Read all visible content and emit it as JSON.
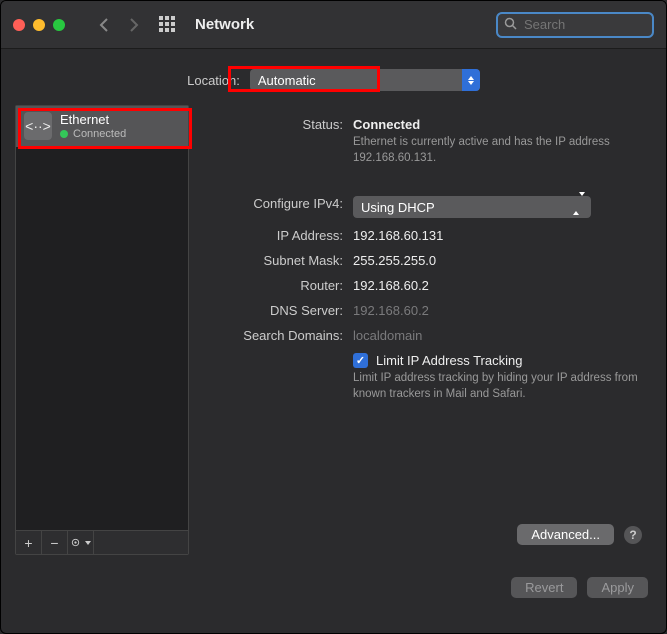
{
  "header": {
    "title": "Network",
    "search_placeholder": "Search"
  },
  "location": {
    "label": "Location:",
    "value": "Automatic"
  },
  "sidebar": {
    "services": [
      {
        "name": "Ethernet",
        "status": "Connected",
        "status_color": "#34c759"
      }
    ],
    "toolbar": {
      "add": "+",
      "remove": "−",
      "gear": "⚙"
    }
  },
  "main": {
    "status_label": "Status:",
    "status_value": "Connected",
    "status_desc": "Ethernet is currently active and has the IP address 192.168.60.131.",
    "ipv4_label": "Configure IPv4:",
    "ipv4_value": "Using DHCP",
    "ip_label": "IP Address:",
    "ip_value": "192.168.60.131",
    "mask_label": "Subnet Mask:",
    "mask_value": "255.255.255.0",
    "router_label": "Router:",
    "router_value": "192.168.60.2",
    "dns_label": "DNS Server:",
    "dns_value": "192.168.60.2",
    "search_label": "Search Domains:",
    "search_value": "localdomain",
    "limit_label": "Limit IP Address Tracking",
    "limit_desc": "Limit IP address tracking by hiding your IP address from known trackers in Mail and Safari.",
    "advanced_label": "Advanced...",
    "help": "?"
  },
  "footer": {
    "revert": "Revert",
    "apply": "Apply"
  }
}
